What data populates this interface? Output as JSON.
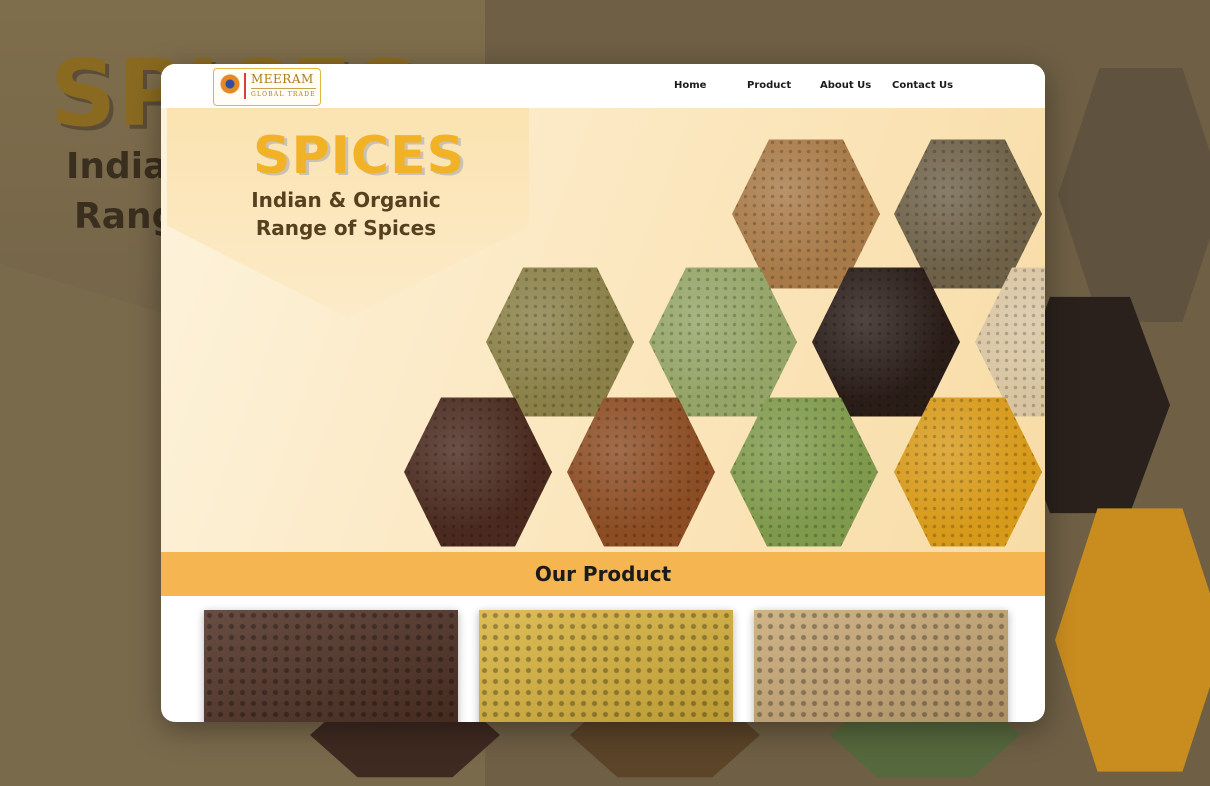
{
  "backdrop": {
    "title": "SPICES",
    "line1": "Indian",
    "line2": "Range"
  },
  "header": {
    "logo_name": "MEERAM",
    "logo_tagline": "GLOBAL TRADE",
    "nav": [
      "Home",
      "Product",
      "About Us",
      "Contact Us"
    ]
  },
  "hero": {
    "title": "SPICES",
    "subtitle_line1": "Indian & Organic",
    "subtitle_line2": "Range of Spices",
    "hexagons": [
      {
        "name": "fenugreek-hex",
        "color": "#a87a48"
      },
      {
        "name": "cumin-hex",
        "color": "#6e6148"
      },
      {
        "name": "coriander-hex",
        "color": "#8a8048"
      },
      {
        "name": "fennel-hex",
        "color": "#94a567"
      },
      {
        "name": "black-pepper-hex",
        "color": "#2a1d18"
      },
      {
        "name": "ginger-hex",
        "color": "#d8c4a0"
      },
      {
        "name": "cloves-hex",
        "color": "#4a2a1f"
      },
      {
        "name": "cinnamon-hex",
        "color": "#8c4d24"
      },
      {
        "name": "cardamom-hex",
        "color": "#7f9a4c"
      },
      {
        "name": "turmeric-hex",
        "color": "#d79a1a"
      }
    ]
  },
  "products_section": {
    "title": "Our Product",
    "cards": [
      {
        "name": "product-cloves",
        "color": "#4d2e22"
      },
      {
        "name": "product-mangoes",
        "color": "#d8b23a"
      },
      {
        "name": "product-almonds",
        "color": "#c8a774"
      }
    ]
  },
  "colors": {
    "accent": "#f2b228",
    "section_bar": "#f5b550",
    "backdrop": "#6e5f45"
  }
}
